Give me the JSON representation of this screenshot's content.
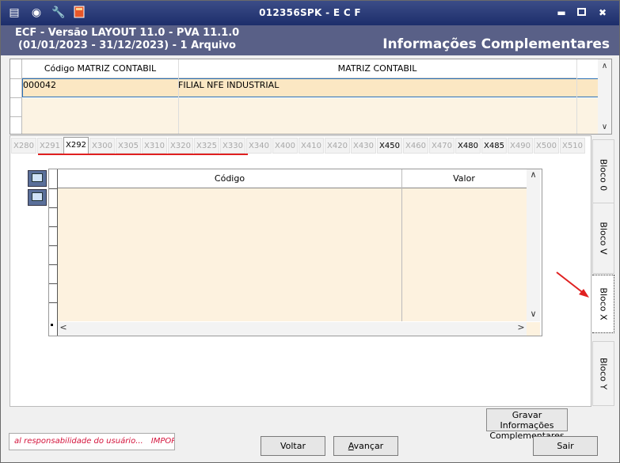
{
  "window": {
    "title": "012356SPK - E C F",
    "header_line1": "ECF - Versão LAYOUT 11.0 - PVA 11.1.0",
    "header_line2": "(01/01/2023 - 31/12/2023) - 1 Arquivo",
    "header_right": "Informações Complementares"
  },
  "top_grid": {
    "columns": [
      "Código MATRIZ CONTABIL",
      "MATRIZ CONTABIL"
    ],
    "rows": [
      {
        "codigo": "000042",
        "matriz": "FILIAL NFE INDUSTRIAL"
      }
    ]
  },
  "tabs": [
    {
      "label": "X280",
      "state": "disabled"
    },
    {
      "label": "X291",
      "state": "disabled"
    },
    {
      "label": "X292",
      "state": "active"
    },
    {
      "label": "X300",
      "state": "disabled"
    },
    {
      "label": "X305",
      "state": "disabled"
    },
    {
      "label": "X310",
      "state": "disabled"
    },
    {
      "label": "X320",
      "state": "disabled"
    },
    {
      "label": "X325",
      "state": "disabled"
    },
    {
      "label": "X330",
      "state": "disabled"
    },
    {
      "label": "X340",
      "state": "disabled"
    },
    {
      "label": "X400",
      "state": "disabled"
    },
    {
      "label": "X410",
      "state": "disabled"
    },
    {
      "label": "X420",
      "state": "disabled"
    },
    {
      "label": "X430",
      "state": "disabled"
    },
    {
      "label": "X450",
      "state": "enabled"
    },
    {
      "label": "X460",
      "state": "disabled"
    },
    {
      "label": "X470",
      "state": "disabled"
    },
    {
      "label": "X480",
      "state": "enabled"
    },
    {
      "label": "X485",
      "state": "enabled"
    },
    {
      "label": "X490",
      "state": "disabled"
    },
    {
      "label": "X500",
      "state": "disabled"
    },
    {
      "label": "X510",
      "state": "disabled"
    }
  ],
  "inner_grid": {
    "columns": [
      "Código",
      "Valor"
    ]
  },
  "side_tabs": [
    {
      "label": "Bloco 0",
      "state": "inactive"
    },
    {
      "label": "Bloco V",
      "state": "inactive"
    },
    {
      "label": "Bloco X",
      "state": "active"
    },
    {
      "label": "Bloco Y",
      "state": "inactive"
    }
  ],
  "buttons": {
    "gravar_line1": "Gravar Informações",
    "gravar_line2": "Complementares",
    "voltar": "Voltar",
    "avancar_first": "A",
    "avancar_rest": "vançar",
    "sair": "Sair"
  },
  "status_bar": {
    "text1": "al responsabilidade do usuário...",
    "text2": "IMPOR"
  },
  "colors": {
    "title_bar": "#1d2e6b",
    "header": "#596087",
    "selected_row": "#fbe7c3",
    "grid_body": "#fdf2df",
    "annotation_red": "#e02020",
    "status_text": "#d4143c"
  }
}
